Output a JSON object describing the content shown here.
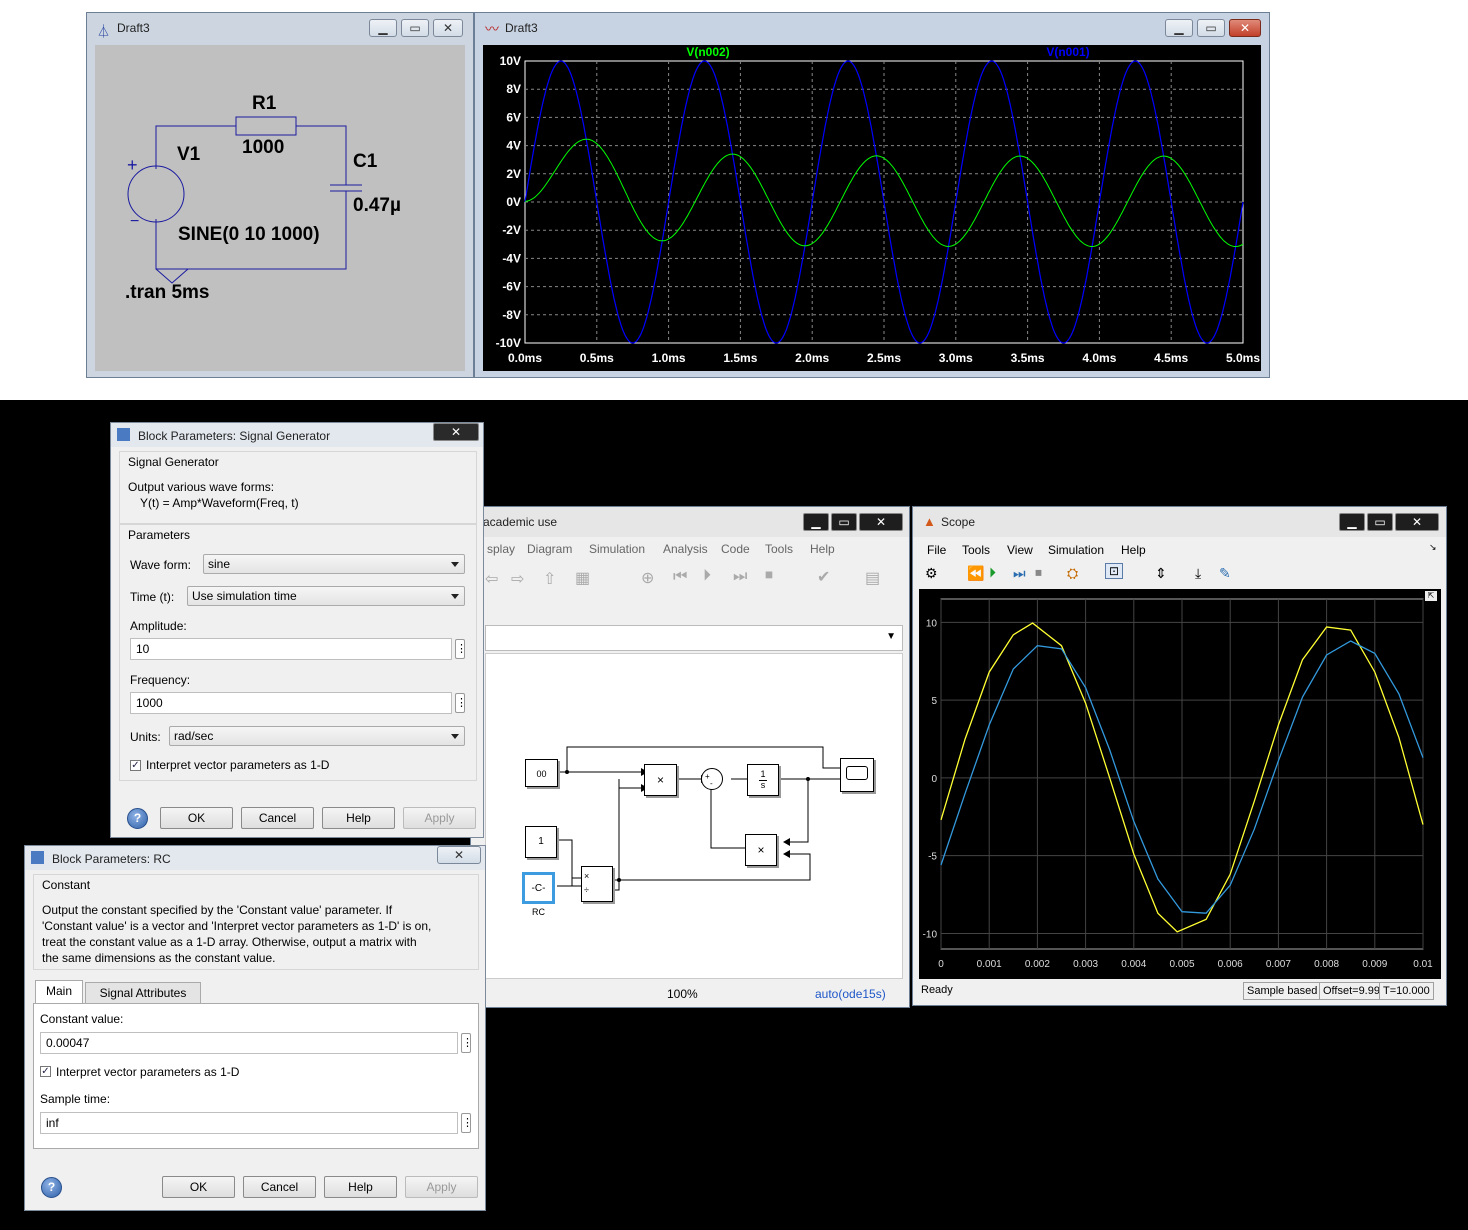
{
  "ltspice_schematic": {
    "title": "Draft3",
    "labels": {
      "r1": "R1",
      "r1_value": "1000",
      "v1": "V1",
      "c1": "C1",
      "c1_value": "0.47µ",
      "source": "SINE(0 10 1000)",
      "tran": ".tran 5ms",
      "plus": "+",
      "minus": "−"
    }
  },
  "ltspice_plot": {
    "title": "Draft3",
    "trace_labels": [
      "V(n002)",
      "V(n001)"
    ],
    "chart_data": {
      "type": "line",
      "x": {
        "label": "",
        "unit": "ms",
        "range": [
          0,
          5
        ],
        "ticks": [
          "0.0ms",
          "0.5ms",
          "1.0ms",
          "1.5ms",
          "2.0ms",
          "2.5ms",
          "3.0ms",
          "3.5ms",
          "4.0ms",
          "4.5ms",
          "5.0ms"
        ]
      },
      "y": {
        "label": "",
        "unit": "V",
        "range": [
          -10,
          10
        ],
        "ticks": [
          "10V",
          "8V",
          "6V",
          "4V",
          "2V",
          "0V",
          "-2V",
          "-4V",
          "-6V",
          "-8V",
          "-10V"
        ]
      },
      "series": [
        {
          "name": "V(n002)",
          "color": "#00ff00",
          "peaks_ms": [
            0.47,
            1.25,
            2.25,
            3.25,
            4.25
          ],
          "peak_values_V": [
            4.3,
            3.2,
            3.2,
            3.2,
            3.2
          ],
          "trough_values_V": [
            -2.7,
            -3.1,
            -3.1,
            -3.1
          ]
        },
        {
          "name": "V(n001)",
          "color": "#0000ff",
          "amplitude_V": 10,
          "frequency_hz": 1000
        }
      ],
      "grid": true
    }
  },
  "signal_generator_dialog": {
    "title": "Block Parameters: Signal Generator",
    "group_title": "Signal Generator",
    "description_line1": "Output various wave forms:",
    "description_line2": "Y(t) = Amp*Waveform(Freq, t)",
    "params_title": "Parameters",
    "wave_form_label": "Wave form:",
    "wave_form_value": "sine",
    "time_label": "Time (t):",
    "time_value": "Use simulation time",
    "amplitude_label": "Amplitude:",
    "amplitude_value": "10",
    "frequency_label": "Frequency:",
    "frequency_value": "1000",
    "units_label": "Units:",
    "units_value": "rad/sec",
    "interpret_label": "Interpret vector parameters as 1-D",
    "buttons": {
      "ok": "OK",
      "cancel": "Cancel",
      "help": "Help",
      "apply": "Apply"
    }
  },
  "rc_dialog": {
    "title": "Block Parameters: RC",
    "group_title": "Constant",
    "description": [
      "Output the constant specified by the 'Constant value' parameter. If",
      "'Constant value' is a vector and 'Interpret vector parameters as 1-D' is on,",
      "treat the constant value as a 1-D array. Otherwise, output a matrix with",
      "the same dimensions as the constant value."
    ],
    "tabs": [
      "Main",
      "Signal Attributes"
    ],
    "constant_label": "Constant value:",
    "constant_value": "0.00047",
    "interpret_label": "Interpret vector parameters as 1-D",
    "sample_time_label": "Sample time:",
    "sample_time_value": "inf",
    "buttons": {
      "ok": "OK",
      "cancel": "Cancel",
      "help": "Help",
      "apply": "Apply"
    }
  },
  "simulink_model": {
    "title": "academic use",
    "menu": [
      "splay",
      "Diagram",
      "Simulation",
      "Analysis",
      "Code",
      "Tools",
      "Help"
    ],
    "blocks": {
      "gen": "00",
      "const1": "1",
      "rc": "-C-",
      "rc_label": "RC",
      "mult": "×",
      "sum_plus": "+",
      "sum_minus": "-",
      "integrator_num": "1",
      "integrator_den": "s",
      "div_top": "×",
      "div_bot": "÷"
    },
    "zoom": "100%",
    "solver": "auto(ode15s)"
  },
  "scope": {
    "title": "Scope",
    "menu": [
      "File",
      "Tools",
      "View",
      "Simulation",
      "Help"
    ],
    "status_left": "Ready",
    "status_mode": "Sample based",
    "status_offset": "Offset=9.99",
    "status_time": "T=10.000",
    "chart_data": {
      "type": "line",
      "x": {
        "label": "",
        "range": [
          0,
          0.01
        ],
        "ticks": [
          "0",
          "0.001",
          "0.002",
          "0.003",
          "0.004",
          "0.005",
          "0.006",
          "0.007",
          "0.008",
          "0.009",
          "0.01"
        ]
      },
      "y": {
        "label": "",
        "range": [
          -11,
          11.5
        ],
        "ticks": [
          "10",
          "5",
          "0",
          "-5",
          "-10"
        ]
      },
      "series": [
        {
          "name": "",
          "color": "#ffff33",
          "x": [
            0,
            0.0005,
            0.001,
            0.0015,
            0.0019,
            0.0025,
            0.003,
            0.0035,
            0.004,
            0.0045,
            0.0049,
            0.0055,
            0.006,
            0.0065,
            0.007,
            0.0075,
            0.008,
            0.0085,
            0.009,
            0.0095,
            0.01
          ],
          "y": [
            -2.7,
            2.5,
            6.8,
            9.2,
            9.95,
            8.5,
            4.8,
            0,
            -4.9,
            -8.7,
            -9.9,
            -9.1,
            -6.2,
            -1.5,
            3.4,
            7.6,
            9.7,
            9.5,
            6.8,
            2.6,
            -3.0
          ]
        },
        {
          "name": "",
          "color": "#3399dd",
          "x": [
            0,
            0.0005,
            0.001,
            0.0015,
            0.002,
            0.0025,
            0.003,
            0.0035,
            0.004,
            0.0045,
            0.005,
            0.0055,
            0.006,
            0.0065,
            0.007,
            0.0075,
            0.008,
            0.0085,
            0.009,
            0.0095,
            0.01
          ],
          "y": [
            -5.6,
            -1.0,
            3.4,
            7.0,
            8.5,
            8.3,
            5.8,
            1.8,
            -2.8,
            -6.5,
            -8.6,
            -8.7,
            -6.9,
            -3.3,
            1.1,
            5.2,
            7.9,
            8.8,
            8.0,
            5.4,
            1.3
          ]
        }
      ],
      "grid": true
    }
  }
}
